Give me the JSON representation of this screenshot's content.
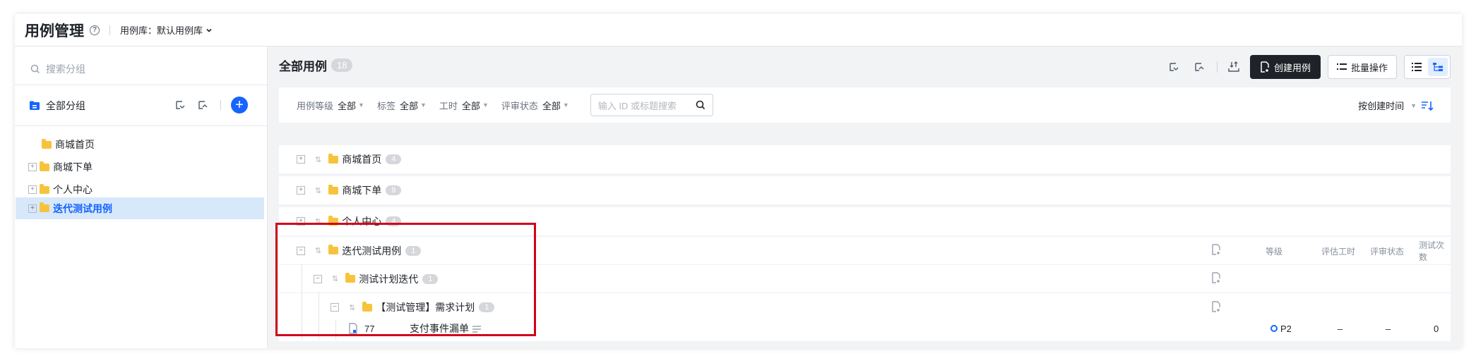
{
  "header": {
    "title": "用例管理",
    "help_glyph": "?",
    "library_label": "用例库：默认用例库"
  },
  "sidebar": {
    "search_placeholder": "搜索分组",
    "all_group_label": "全部分组",
    "tree": [
      {
        "label": "商城首页",
        "expandable": false,
        "selected": false
      },
      {
        "label": "商城下单",
        "expandable": true,
        "selected": false
      },
      {
        "label": "个人中心",
        "expandable": true,
        "selected": false
      },
      {
        "label": "迭代测试用例",
        "expandable": true,
        "selected": true
      }
    ]
  },
  "main": {
    "title": "全部用例",
    "count": "18",
    "create_label": "创建用例",
    "batch_label": "批量操作",
    "filters": [
      {
        "key": "用例等级",
        "value": "全部"
      },
      {
        "key": "标签",
        "value": "全部"
      },
      {
        "key": "工时",
        "value": "全部"
      },
      {
        "key": "评审状态",
        "value": "全部"
      }
    ],
    "search_placeholder": "输入 ID 或标题搜索",
    "sort_label": "按创建时间",
    "groups": [
      {
        "name": "商城首页",
        "count": "4"
      },
      {
        "name": "商城下单",
        "count": "9"
      },
      {
        "name": "个人中心",
        "count": "4"
      }
    ],
    "expanded_group": {
      "name": "迭代测试用例",
      "count": "1"
    },
    "sub_group": {
      "name": "测试计划迭代",
      "count": "1"
    },
    "sub_sub_group": {
      "name": "【测试管理】需求计划",
      "count": "1"
    },
    "columns": [
      "等级",
      "评估工时",
      "评审状态",
      "测试次数"
    ],
    "case": {
      "id": "77",
      "title": "支付事件漏单",
      "priority": "P2",
      "hours": "–",
      "review": "–",
      "runs": "0"
    }
  },
  "colors": {
    "accent": "#1664ff",
    "folder": "#f8c33c",
    "highlight": "#d0021b"
  }
}
